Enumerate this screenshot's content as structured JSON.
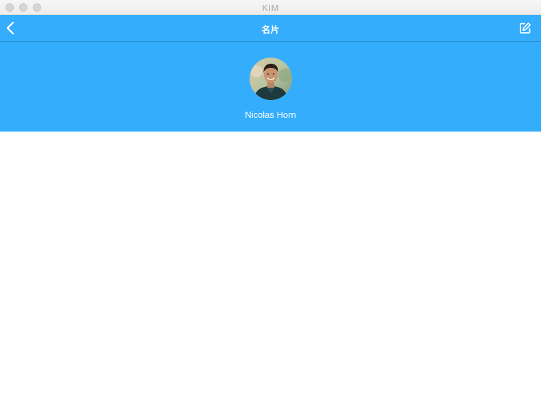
{
  "window": {
    "title": "KIM"
  },
  "navbar": {
    "title": "名片",
    "back_icon": "chevron-left-icon",
    "edit_icon": "edit-icon"
  },
  "profile": {
    "name": "Nicolas Horn",
    "avatar": "user-avatar-photo"
  },
  "colors": {
    "accent": "#33adfc",
    "text_on_accent": "#ffffff"
  }
}
